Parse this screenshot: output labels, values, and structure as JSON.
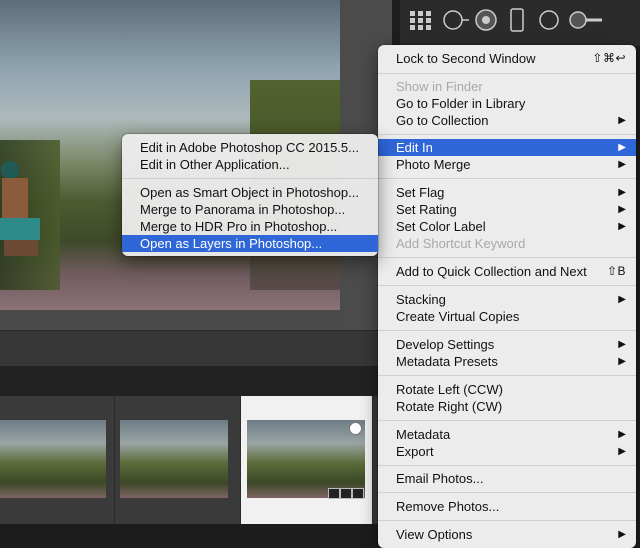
{
  "main_menu": {
    "items": [
      {
        "label": "Lock to Second Window",
        "shortcut": "⇧⌘↩"
      },
      {
        "label": "Show in Finder"
      },
      {
        "label": "Go to Folder in Library"
      },
      {
        "label": "Go to Collection",
        "arrow": "▶"
      },
      {
        "label": "Edit In",
        "arrow": "▶"
      },
      {
        "label": "Photo Merge",
        "arrow": "▶"
      },
      {
        "label": "Set Flag",
        "arrow": "▶"
      },
      {
        "label": "Set Rating",
        "arrow": "▶"
      },
      {
        "label": "Set Color Label",
        "arrow": "▶"
      },
      {
        "label": "Add Shortcut Keyword"
      },
      {
        "label": "Add to Quick Collection and Next",
        "shortcut": "⇧B"
      },
      {
        "label": "Stacking",
        "arrow": "▶"
      },
      {
        "label": "Create Virtual Copies"
      },
      {
        "label": "Develop Settings",
        "arrow": "▶"
      },
      {
        "label": "Metadata Presets",
        "arrow": "▶"
      },
      {
        "label": "Rotate Left (CCW)"
      },
      {
        "label": "Rotate Right (CW)"
      },
      {
        "label": "Metadata",
        "arrow": "▶"
      },
      {
        "label": "Export",
        "arrow": "▶"
      },
      {
        "label": "Email Photos..."
      },
      {
        "label": "Remove Photos..."
      },
      {
        "label": "View Options",
        "arrow": "▶"
      }
    ]
  },
  "edit_in_submenu": {
    "items": [
      {
        "label": "Edit in Adobe Photoshop CC 2015.5..."
      },
      {
        "label": "Edit in Other Application..."
      },
      {
        "label": "Open as Smart Object in Photoshop..."
      },
      {
        "label": "Merge to Panorama in Photoshop..."
      },
      {
        "label": "Merge to HDR Pro in Photoshop..."
      },
      {
        "label": "Open as Layers in Photoshop..."
      }
    ]
  },
  "colors": {
    "highlight": "#2f66d8",
    "menu_bg": "#ececec",
    "disabled_text": "#a9a9a9"
  },
  "toolbar_icons": [
    "grid-view-icon",
    "loupe-view-icon",
    "target-icon",
    "phone-icon",
    "circle-icon",
    "slider-icon"
  ]
}
